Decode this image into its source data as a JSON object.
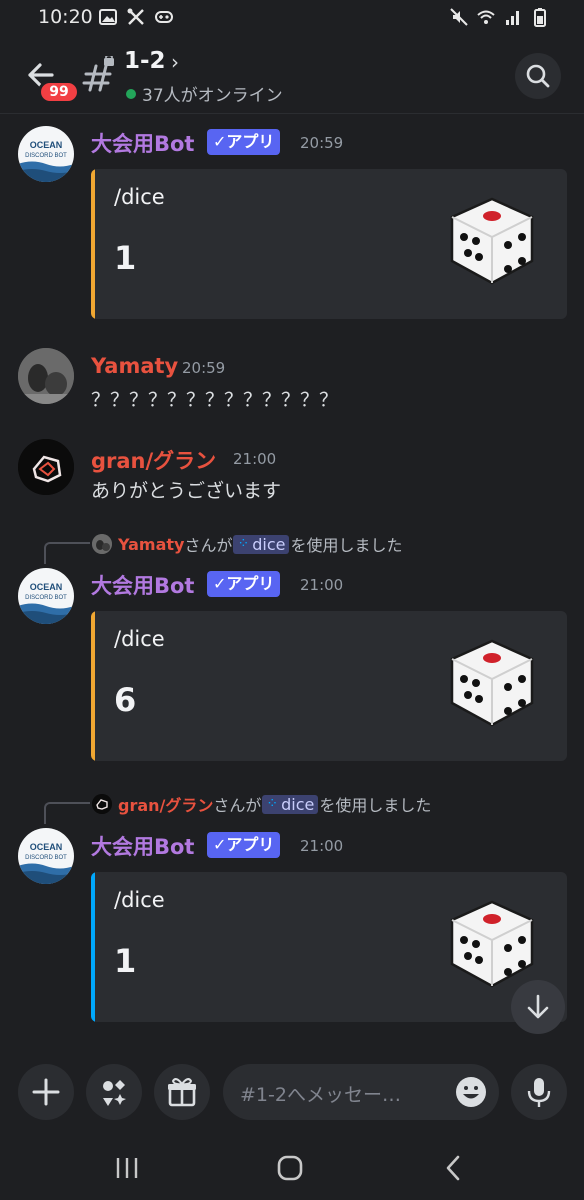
{
  "status_bar": {
    "time": "10:20",
    "left_icons": [
      "image-icon",
      "tools-icon",
      "game-controller-icon"
    ],
    "right_icons": [
      "mute-icon",
      "wifi-icon",
      "signal-icon",
      "battery-icon"
    ]
  },
  "header": {
    "unread_badge": "99",
    "channel_name": "1-2",
    "online_text": "37人がオンライン"
  },
  "messages": [
    {
      "author": "大会用Bot",
      "tag": "✓アプリ",
      "time": "20:59",
      "embed": {
        "title": "/dice",
        "value": "1",
        "bar_color": "#f0a732"
      }
    },
    {
      "author": "Yamaty",
      "time": "20:59",
      "text": "？？？？？？？？？？？？？"
    },
    {
      "author": "gran/グラン",
      "time": "21:00",
      "text": "ありがとうございます"
    },
    {
      "reply": {
        "user": "Yamaty",
        "mid": "さんが",
        "command": "dice",
        "tail": "を使用しました"
      },
      "author": "大会用Bot",
      "tag": "✓アプリ",
      "time": "21:00",
      "embed": {
        "title": "/dice",
        "value": "6",
        "bar_color": "#f0a732"
      }
    },
    {
      "reply": {
        "user": "gran/グラン",
        "mid": "さんが",
        "command": "dice",
        "tail": "を使用しました"
      },
      "author": "大会用Bot",
      "tag": "✓アプリ",
      "time": "21:00",
      "embed": {
        "title": "/dice",
        "value": "1",
        "bar_color": "#00a8fc"
      }
    }
  ],
  "composer": {
    "placeholder": "#1-2へメッセー…"
  },
  "colors": {
    "background": "#1e1f22",
    "embed_bg": "#2b2d31",
    "bot_name": "#b279e0",
    "user_name": "#e8523f",
    "app_tag": "#5865f2",
    "online": "#23a55a",
    "badge": "#f23f43"
  }
}
